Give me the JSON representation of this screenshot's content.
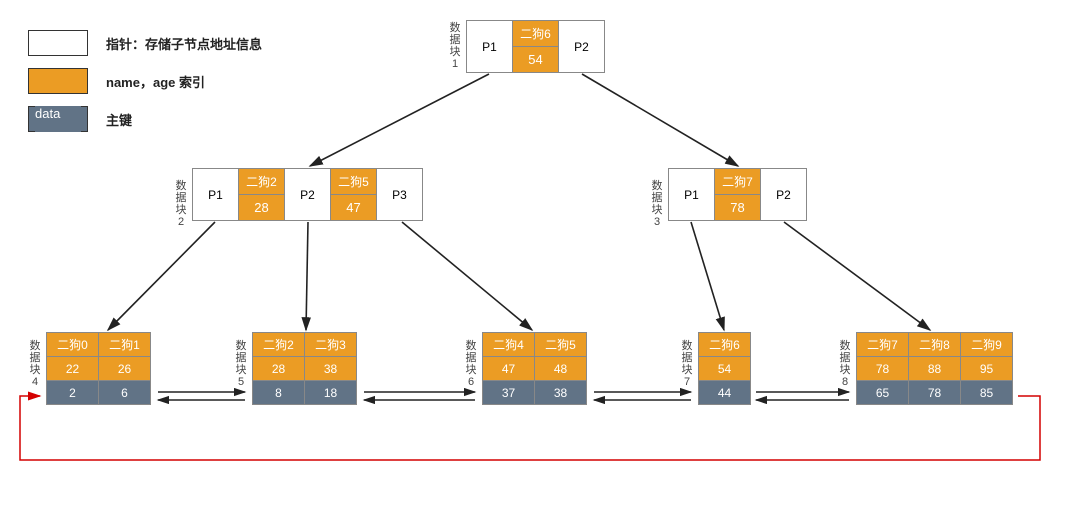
{
  "legend": {
    "pointer": "指针：存储子节点地址信息",
    "index": "name，age 索引",
    "data": "data",
    "primary": "主键"
  },
  "block_label_prefix": "数据块",
  "nodes": {
    "root": {
      "block": "1",
      "cells": [
        "P1",
        "二狗6",
        "54",
        "P2"
      ]
    },
    "mid_left": {
      "block": "2",
      "cells": [
        "P1",
        "二狗2",
        "28",
        "P2",
        "二狗5",
        "47",
        "P3"
      ]
    },
    "mid_right": {
      "block": "3",
      "cells": [
        "P1",
        "二狗7",
        "78",
        "P2"
      ]
    }
  },
  "leaves": [
    {
      "block": "4",
      "names": [
        "二狗0",
        "二狗1"
      ],
      "ages": [
        "22",
        "26"
      ],
      "data": [
        "2",
        "6"
      ]
    },
    {
      "block": "5",
      "names": [
        "二狗2",
        "二狗3"
      ],
      "ages": [
        "28",
        "38"
      ],
      "data": [
        "8",
        "18"
      ]
    },
    {
      "block": "6",
      "names": [
        "二狗4",
        "二狗5"
      ],
      "ages": [
        "47",
        "48"
      ],
      "data": [
        "37",
        "38"
      ]
    },
    {
      "block": "7",
      "names": [
        "二狗6"
      ],
      "ages": [
        "54"
      ],
      "data": [
        "44"
      ]
    },
    {
      "block": "8",
      "names": [
        "二狗7",
        "二狗8",
        "二狗9"
      ],
      "ages": [
        "78",
        "88",
        "95"
      ],
      "data": [
        "65",
        "78",
        "85"
      ]
    }
  ],
  "chart_data": {
    "type": "diagram",
    "subtype": "b-plus-tree-index",
    "legend": {
      "white": "指针：存储子节点地址信息",
      "orange": "name，age 索引",
      "gray_data": "主键"
    },
    "internal_nodes": [
      {
        "id": 1,
        "pointers": [
          "P1",
          "P2"
        ],
        "keys": [
          {
            "name": "二狗6",
            "age": 54
          }
        ]
      },
      {
        "id": 2,
        "pointers": [
          "P1",
          "P2",
          "P3"
        ],
        "keys": [
          {
            "name": "二狗2",
            "age": 28
          },
          {
            "name": "二狗5",
            "age": 47
          }
        ]
      },
      {
        "id": 3,
        "pointers": [
          "P1",
          "P2"
        ],
        "keys": [
          {
            "name": "二狗7",
            "age": 78
          }
        ]
      }
    ],
    "leaf_nodes": [
      {
        "id": 4,
        "entries": [
          {
            "name": "二狗0",
            "age": 22,
            "pk": 2
          },
          {
            "name": "二狗1",
            "age": 26,
            "pk": 6
          }
        ]
      },
      {
        "id": 5,
        "entries": [
          {
            "name": "二狗2",
            "age": 28,
            "pk": 8
          },
          {
            "name": "二狗3",
            "age": 38,
            "pk": 18
          }
        ]
      },
      {
        "id": 6,
        "entries": [
          {
            "name": "二狗4",
            "age": 47,
            "pk": 37
          },
          {
            "name": "二狗5",
            "age": 48,
            "pk": 38
          }
        ]
      },
      {
        "id": 7,
        "entries": [
          {
            "name": "二狗6",
            "age": 54,
            "pk": 44
          }
        ]
      },
      {
        "id": 8,
        "entries": [
          {
            "name": "二狗7",
            "age": 78,
            "pk": 65
          },
          {
            "name": "二狗8",
            "age": 88,
            "pk": 78
          },
          {
            "name": "二狗9",
            "age": 95,
            "pk": 85
          }
        ]
      }
    ],
    "edges_internal": [
      {
        "from": 1,
        "ptr": "P1",
        "to": 2
      },
      {
        "from": 1,
        "ptr": "P2",
        "to": 3
      },
      {
        "from": 2,
        "ptr": "P1",
        "to": 4
      },
      {
        "from": 2,
        "ptr": "P2",
        "to": 5
      },
      {
        "from": 2,
        "ptr": "P3",
        "to": 6
      },
      {
        "from": 3,
        "ptr": "P1",
        "to": 7
      },
      {
        "from": 3,
        "ptr": "P2",
        "to": 8
      }
    ],
    "leaf_chain_double_linked": [
      4,
      5,
      6,
      7,
      8
    ],
    "red_loop_from_last_to_first": true
  }
}
